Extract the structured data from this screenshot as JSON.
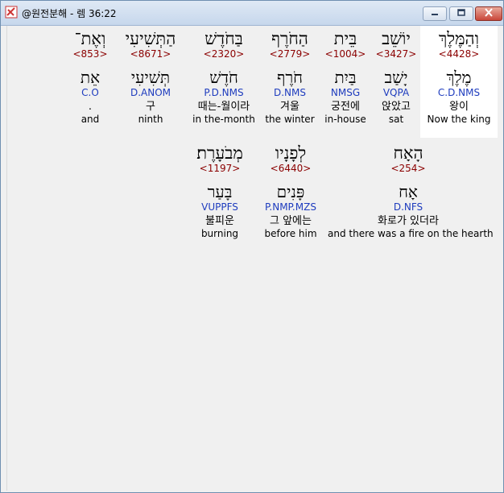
{
  "window": {
    "title": "@원전분해 - 렘 36:22"
  },
  "colors": {
    "strong": "#8b0000",
    "morph": "#1e3cbe",
    "text": "#000000",
    "background": "#f0f0f0",
    "highlight": "#ffffff"
  },
  "row1": [
    {
      "hebrew": "וְהַמֶּלֶךְ",
      "strong": "<4428>",
      "lemma": "מֶלֶךְ",
      "morph": "C.D.NMS",
      "korean": "왕이",
      "english": "Now the king"
    },
    {
      "hebrew": "יוֹשֵׁב",
      "strong": "<3427>",
      "lemma": "יָשַׁב",
      "morph": "VQPA",
      "korean": "앉았고",
      "english": "sat"
    },
    {
      "hebrew": "בֵּית",
      "strong": "<1004>",
      "lemma": "בַּיִת",
      "morph": "NMSG",
      "korean": "궁전에",
      "english": "in-house"
    },
    {
      "hebrew": "הַחֹרֶף",
      "strong": "<2779>",
      "lemma": "חֹרֶף",
      "morph": "D.NMS",
      "korean": "겨울",
      "english": "the winter"
    },
    {
      "hebrew": "בַּחֹדֶשׁ",
      "strong": "<2320>",
      "lemma": "חֹדֶשׁ",
      "morph": "P.D.NMS",
      "korean": "때는-월이라",
      "english": "in the-month"
    },
    {
      "hebrew": "הַתְּשִׁיעִי",
      "strong": "<8671>",
      "lemma": "תְּשִׁיעִי",
      "morph": "D.ANOM",
      "korean": "구",
      "english": "ninth"
    },
    {
      "hebrew": "וְאֶת־",
      "strong": "<853>",
      "lemma": "אֵת",
      "morph": "C.O",
      "korean": ".",
      "english": "and"
    }
  ],
  "row2": [
    {
      "hebrew": "הָאָח",
      "strong": "<254>",
      "lemma": "אָח",
      "morph": "D.NFS",
      "korean": "화로가 있더라",
      "english": "and there was a fire on the hearth"
    },
    {
      "hebrew": "לְפָנָיו",
      "strong": "<6440>",
      "lemma": "פָּנִים",
      "morph": "P.NMP.MZS",
      "korean": "그 앞에는",
      "english": "before him"
    },
    {
      "hebrew": "מְבֹעָרֶת׃",
      "strong": "<1197>",
      "lemma": "בָּעַר",
      "morph": "VUPPFS",
      "korean": "불피운",
      "english": "burning"
    }
  ]
}
